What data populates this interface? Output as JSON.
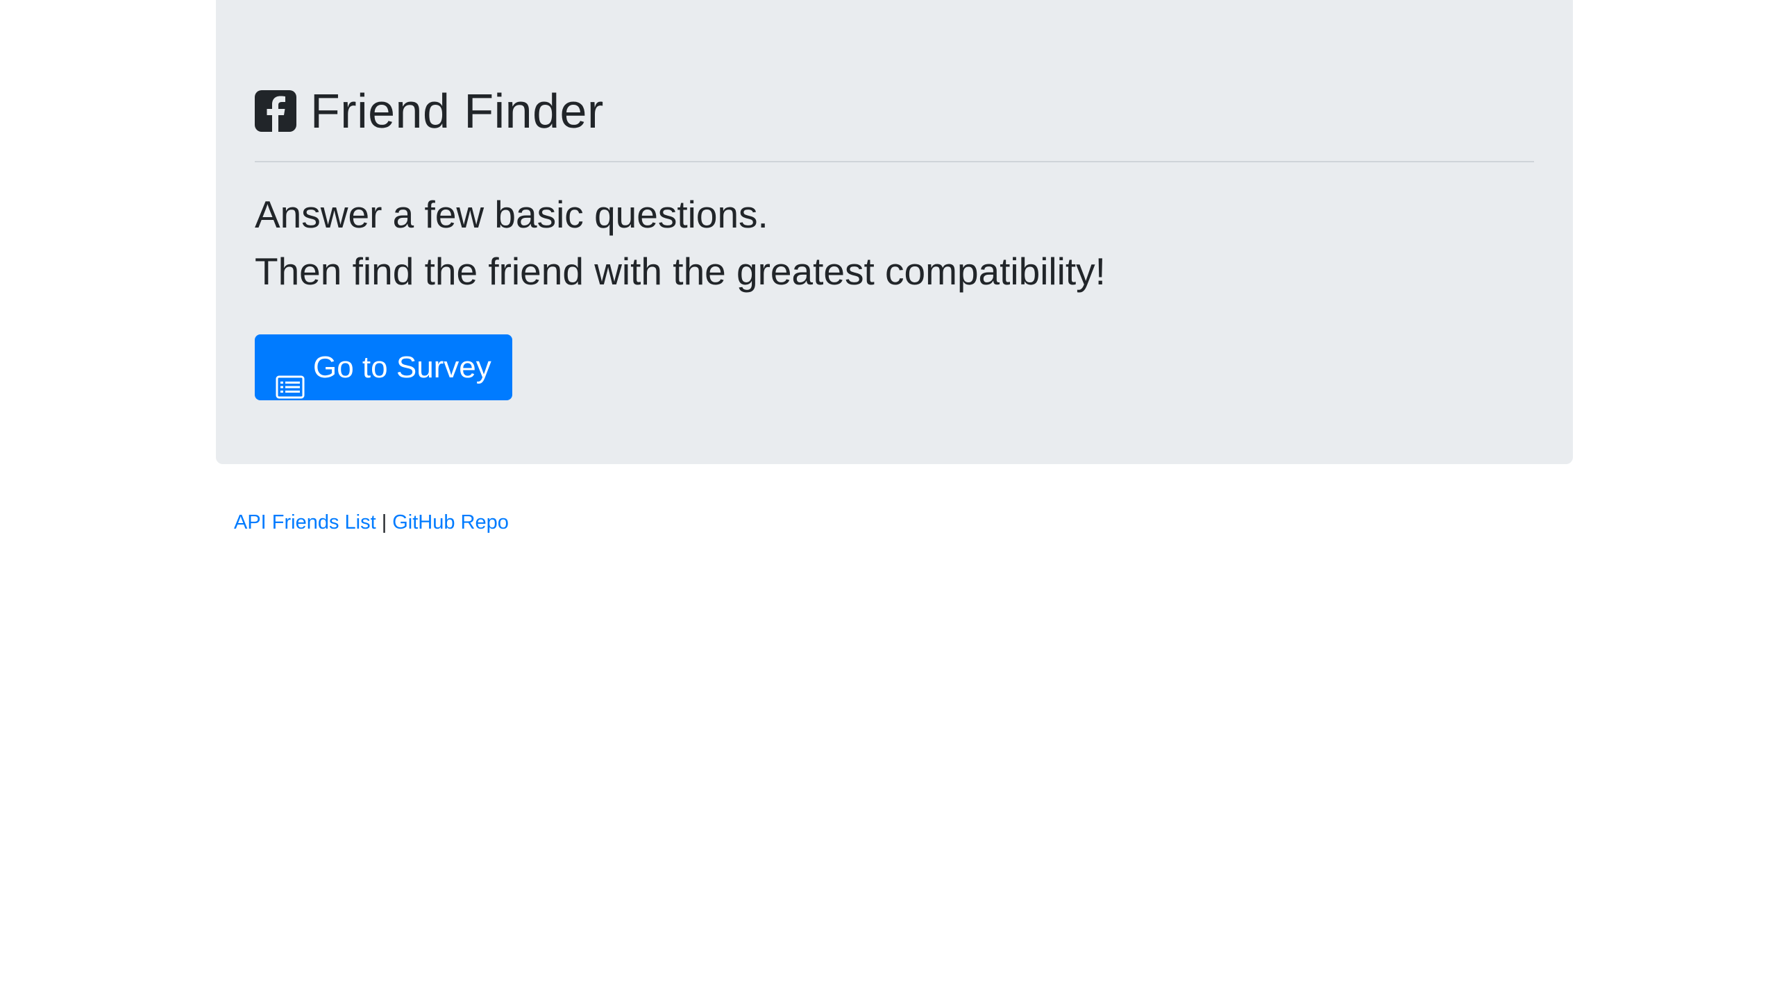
{
  "header": {
    "title": "Friend Finder",
    "icon": "facebook-square-icon"
  },
  "lead": {
    "line1": "Answer a few basic questions.",
    "line2": "Then find the friend with the greatest compatibility!"
  },
  "survey_button": {
    "label": "Go to Survey",
    "icon": "list-alt-icon"
  },
  "footer": {
    "api_link": "API Friends List",
    "separator": "|",
    "github_link": "GitHub Repo"
  },
  "colors": {
    "jumbotron_bg": "#e9ecef",
    "primary": "#007bff",
    "text": "#212529"
  }
}
